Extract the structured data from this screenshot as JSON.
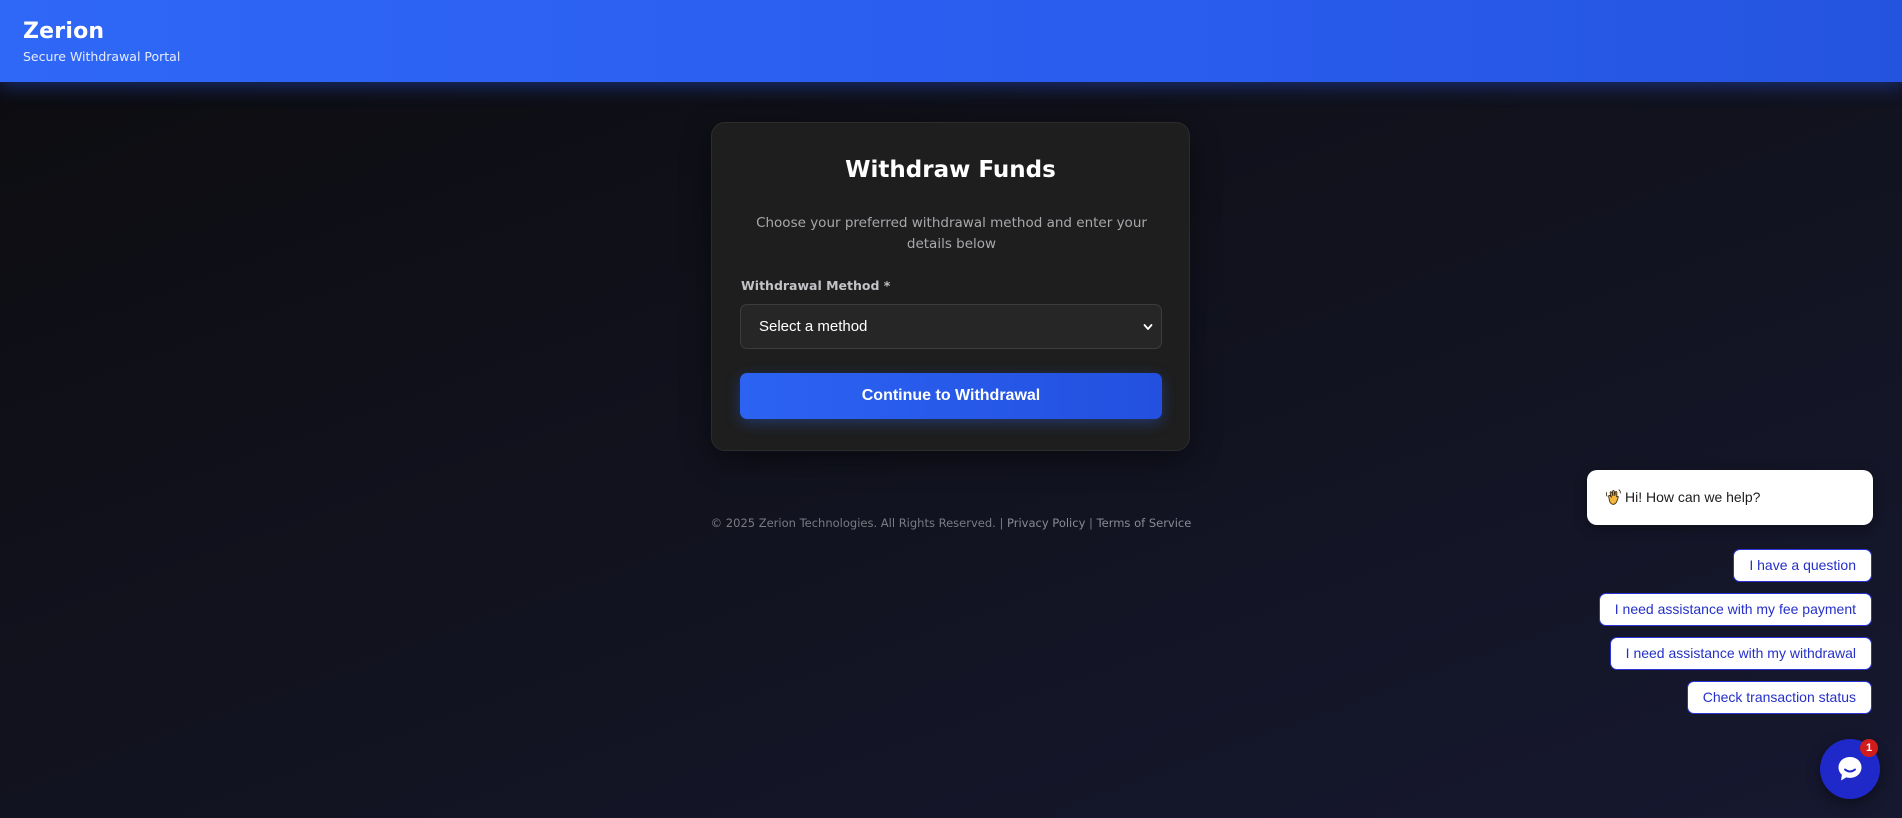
{
  "header": {
    "brand": "Zerion",
    "subtitle": "Secure Withdrawal Portal"
  },
  "form": {
    "title": "Withdraw Funds",
    "description": "Choose your preferred withdrawal method and enter your details below",
    "method_label": "Withdrawal Method *",
    "method_selected": "Select a method",
    "submit_label": "Continue to Withdrawal"
  },
  "footer": {
    "copyright": "© 2025 Zerion Technologies. All Rights Reserved.",
    "separator": "|",
    "privacy": "Privacy Policy",
    "terms": "Terms of Service"
  },
  "chat": {
    "greeting_icon": "waving-hand-icon",
    "greeting": "Hi! How can we help?",
    "quick_replies": [
      "I have a question",
      "I need assistance with my fee payment",
      "I need assistance with my withdrawal",
      "Check transaction status"
    ],
    "launcher_icon": "chat-bubble-icon",
    "unread_count": "1"
  },
  "colors": {
    "accent": "#2c63f3",
    "chat_accent": "#1f28c9",
    "badge": "#d11c1c"
  }
}
